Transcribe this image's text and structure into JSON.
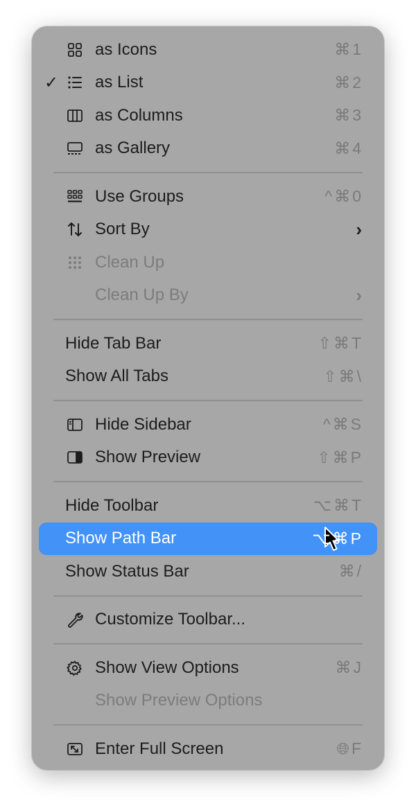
{
  "menu": {
    "view_as": [
      {
        "label": "as Icons",
        "shortcut": "⌘1",
        "icon": "icons-grid-icon",
        "checked": false
      },
      {
        "label": "as List",
        "shortcut": "⌘2",
        "icon": "list-icon",
        "checked": true
      },
      {
        "label": "as Columns",
        "shortcut": "⌘3",
        "icon": "columns-icon",
        "checked": false
      },
      {
        "label": "as Gallery",
        "shortcut": "⌘4",
        "icon": "gallery-icon",
        "checked": false
      }
    ],
    "check_mark": "✓",
    "arrange": [
      {
        "label": "Use Groups",
        "shortcut": "^⌘0",
        "icon": "groups-icon"
      },
      {
        "label": "Sort By",
        "submenu": "›",
        "icon": "sort-icon"
      },
      {
        "label": "Clean Up",
        "icon": "clean-up-icon",
        "disabled": true
      },
      {
        "label": "Clean Up By",
        "submenu": "›",
        "disabled": true
      }
    ],
    "tabs": [
      {
        "label": "Hide Tab Bar",
        "shortcut": "⇧⌘T"
      },
      {
        "label": "Show All Tabs",
        "shortcut": "⇧⌘\\"
      }
    ],
    "panels": [
      {
        "label": "Hide Sidebar",
        "shortcut": "^⌘S",
        "icon": "sidebar-icon"
      },
      {
        "label": "Show Preview",
        "shortcut": "⇧⌘P",
        "icon": "preview-icon"
      }
    ],
    "bars": [
      {
        "label": "Hide Toolbar",
        "shortcut": "⌥⌘T"
      },
      {
        "label": "Show Path Bar",
        "shortcut": "⌥⌘P",
        "highlighted": true
      },
      {
        "label": "Show Status Bar",
        "shortcut": "⌘/"
      }
    ],
    "customize": {
      "label": "Customize Toolbar...",
      "icon": "wrench-icon"
    },
    "options": [
      {
        "label": "Show View Options",
        "shortcut": "⌘J",
        "icon": "gear-icon"
      },
      {
        "label": "Show Preview Options",
        "disabled": true
      }
    ],
    "fullscreen": {
      "label": "Enter Full Screen",
      "shortcut": "🌐︎F",
      "icon": "full-screen-icon"
    }
  },
  "colors": {
    "menu_background": "#a7a7a7",
    "highlight": "#4392f7",
    "text": "#1c1c1c",
    "disabled_text": "#7c7c7c",
    "shortcut_text": "#7a7a7a"
  }
}
